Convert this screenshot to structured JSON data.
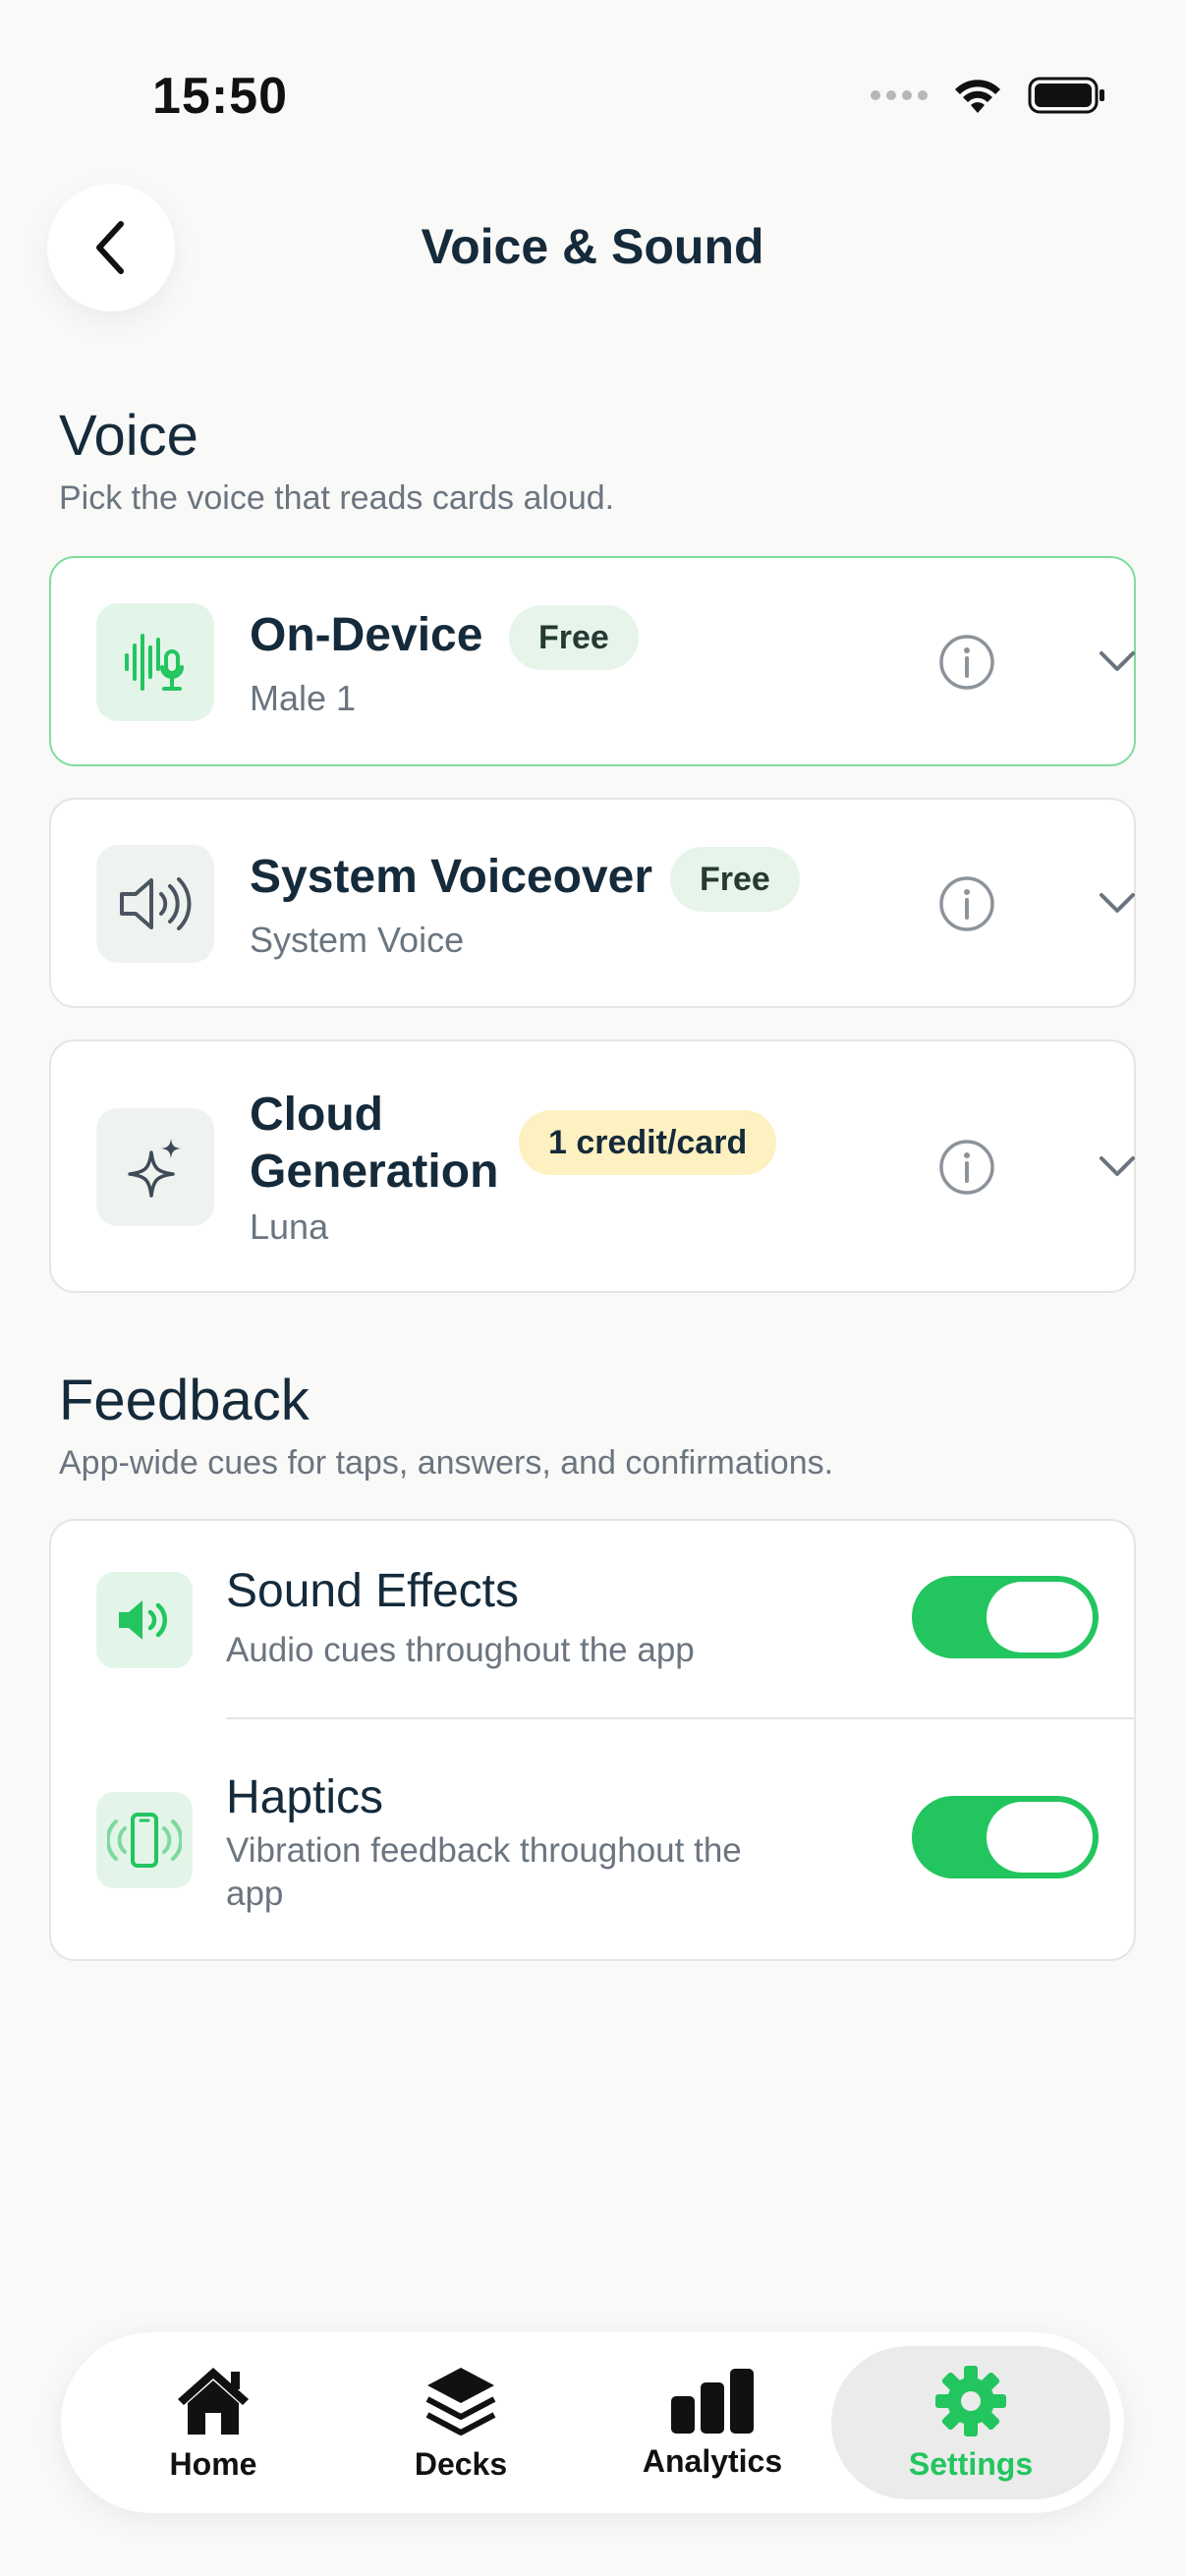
{
  "status": {
    "time": "15:50"
  },
  "header": {
    "title": "Voice & Sound"
  },
  "voice_section": {
    "title": "Voice",
    "subtitle": "Pick the voice that reads cards aloud.",
    "options": [
      {
        "name": "On-Device",
        "sub": "Male 1",
        "badge": "Free",
        "icon": "waveform-mic-icon",
        "selected": true
      },
      {
        "name": "System Voiceover",
        "sub": "System Voice",
        "badge": "Free",
        "icon": "speaker-icon",
        "selected": false
      },
      {
        "name": "Cloud Generation",
        "sub": "Luna",
        "badge": "1 credit/card",
        "icon": "sparkles-icon",
        "selected": false
      }
    ]
  },
  "feedback_section": {
    "title": "Feedback",
    "subtitle": "App-wide cues for taps, answers, and confirmations.",
    "items": [
      {
        "name": "Sound Effects",
        "sub": "Audio cues throughout the app",
        "icon": "speaker-volume-icon",
        "on": true
      },
      {
        "name": "Haptics",
        "sub": "Vibration feedback throughout the app",
        "icon": "phone-vibrate-icon",
        "on": true
      }
    ]
  },
  "tabbar": {
    "tabs": [
      {
        "label": "Home",
        "icon": "house-icon"
      },
      {
        "label": "Decks",
        "icon": "layers-icon"
      },
      {
        "label": "Analytics",
        "icon": "bar-chart-icon"
      },
      {
        "label": "Settings",
        "icon": "gear-icon",
        "active": true
      }
    ]
  },
  "colors": {
    "accent": "#22c55e",
    "selected_border": "#7fdc9f",
    "badge_free_bg": "#e6f4ea",
    "badge_credit_bg": "#fdf0c1"
  }
}
